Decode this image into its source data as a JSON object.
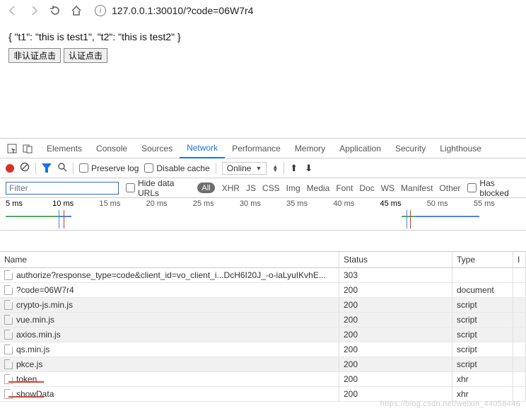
{
  "nav": {
    "url": "127.0.0.1:30010/?code=06W7r4"
  },
  "page": {
    "json_text": "{ \"t1\": \"this is test1\", \"t2\": \"this is test2\" }",
    "btn_unauth": "非认证点击",
    "btn_auth": "认证点击"
  },
  "tabs": {
    "elements": "Elements",
    "console": "Console",
    "sources": "Sources",
    "network": "Network",
    "performance": "Performance",
    "memory": "Memory",
    "application": "Application",
    "security": "Security",
    "lighthouse": "Lighthouse"
  },
  "toolbar": {
    "preserve": "Preserve log",
    "disable": "Disable cache",
    "throttle": "Online"
  },
  "filter": {
    "placeholder": "Filter",
    "hide": "Hide data URLs",
    "all": "All",
    "types": [
      "XHR",
      "JS",
      "CSS",
      "Img",
      "Media",
      "Font",
      "Doc",
      "WS",
      "Manifest",
      "Other"
    ],
    "hasblocked": "Has blocked"
  },
  "timeline": {
    "ticks": [
      "5 ms",
      "10 ms",
      "15 ms",
      "20 ms",
      "25 ms",
      "30 ms",
      "35 ms",
      "40 ms",
      "45 ms",
      "50 ms",
      "55 ms"
    ],
    "bold": [
      0,
      1,
      8
    ]
  },
  "table": {
    "headers": {
      "name": "Name",
      "status": "Status",
      "type": "Type",
      "initiator": "I"
    },
    "rows": [
      {
        "name": "authorize?response_type=code&client_id=vo_client_i...DcH6I20J_-o-iaLyuIKvhE...",
        "status": "303",
        "type": "",
        "dim": false
      },
      {
        "name": "?code=06W7r4",
        "status": "200",
        "type": "document",
        "dim": false
      },
      {
        "name": "crypto-js.min.js",
        "status": "200",
        "type": "script",
        "dim": true
      },
      {
        "name": "vue.min.js",
        "status": "200",
        "type": "script",
        "dim": true
      },
      {
        "name": "axios.min.js",
        "status": "200",
        "type": "script",
        "dim": true
      },
      {
        "name": "qs.min.js",
        "status": "200",
        "type": "script",
        "dim": false
      },
      {
        "name": "pkce.js",
        "status": "200",
        "type": "script",
        "dim": true
      },
      {
        "name": "token",
        "status": "200",
        "type": "xhr",
        "dim": false
      },
      {
        "name": "showData",
        "status": "200",
        "type": "xhr",
        "dim": false
      }
    ]
  },
  "watermark": "https://blog.csdn.net/weixin_44058446"
}
